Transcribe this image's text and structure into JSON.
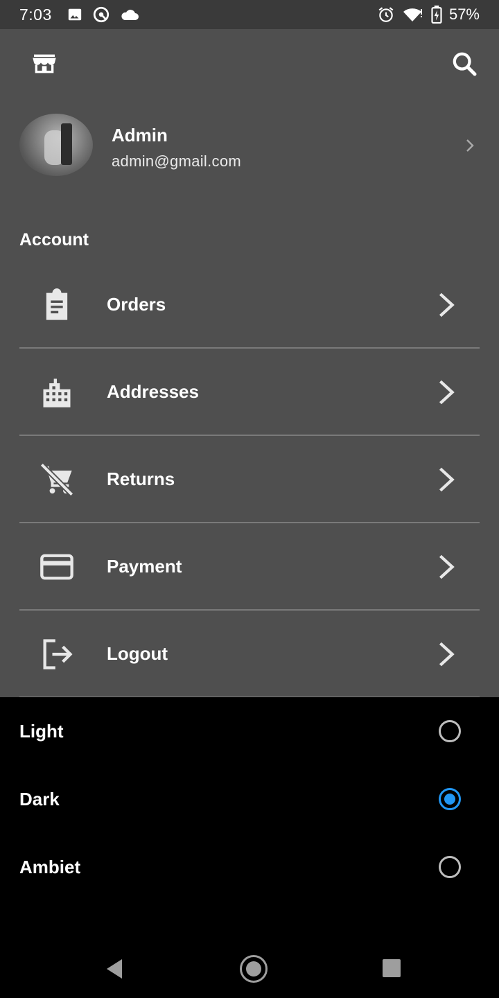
{
  "status_bar": {
    "time": "7:03",
    "battery": "57%",
    "icons": [
      "image-icon",
      "sync-icon",
      "cloud-icon",
      "alarm-icon",
      "wifi-icon",
      "battery-charging-icon"
    ]
  },
  "app_bar": {
    "left_icon": "store-icon",
    "right_icon": "search-icon"
  },
  "profile": {
    "name": "Admin",
    "email": "admin@gmail.com"
  },
  "account": {
    "title": "Account",
    "items": [
      {
        "label": "Orders",
        "icon": "clipboard-icon"
      },
      {
        "label": "Addresses",
        "icon": "building-icon"
      },
      {
        "label": "Returns",
        "icon": "cart-off-icon"
      },
      {
        "label": "Payment",
        "icon": "credit-card-icon"
      },
      {
        "label": "Logout",
        "icon": "logout-icon"
      }
    ]
  },
  "theme": {
    "options": [
      {
        "label": "Light",
        "selected": false
      },
      {
        "label": "Dark",
        "selected": true
      },
      {
        "label": "Ambiet",
        "selected": false
      }
    ],
    "accent_color": "#2196f3"
  },
  "colors": {
    "panel": "#4f4f4f",
    "status_bar": "#3a3a3a",
    "background": "#000000"
  }
}
